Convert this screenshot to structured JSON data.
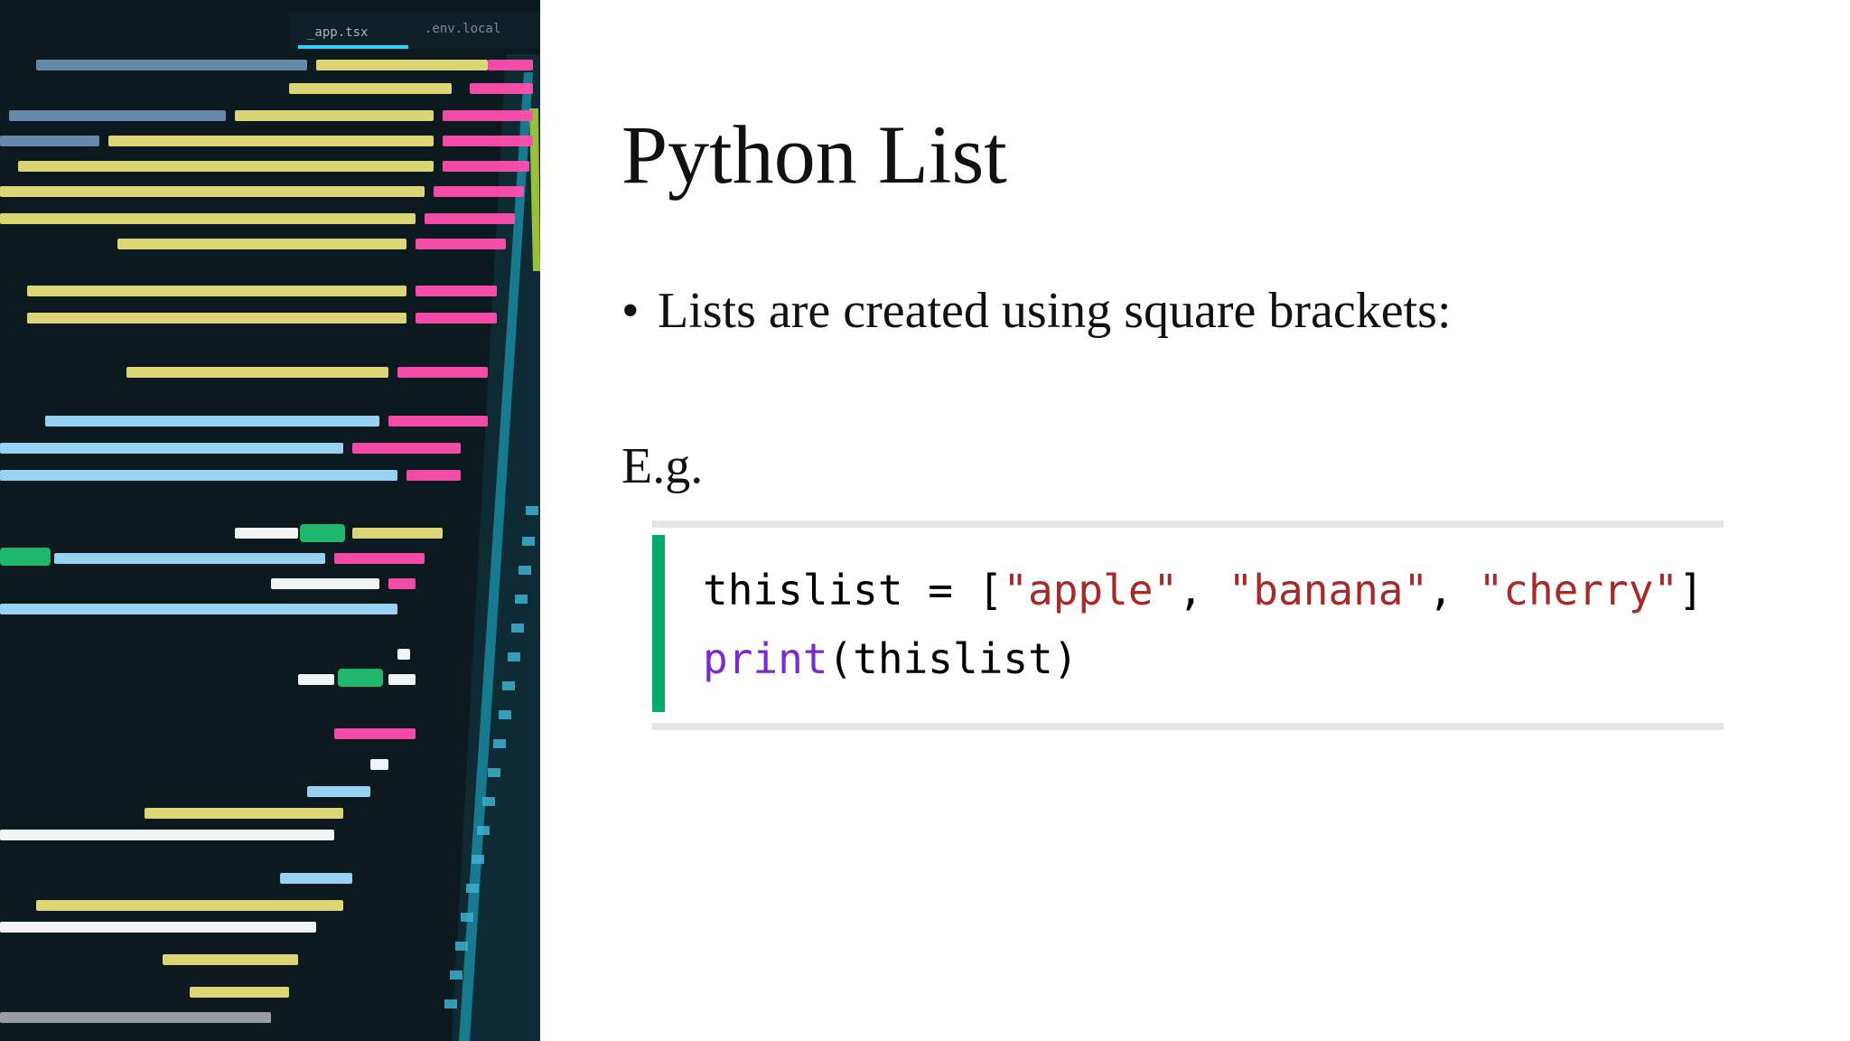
{
  "slide": {
    "title": "Python List",
    "bullet": "Lists are created using square brackets:",
    "example_label": "E.g."
  },
  "code_example": {
    "line1_var": "thislist = [",
    "line1_s1": "\"apple\"",
    "line1_sep1": ", ",
    "line1_s2": "\"banana\"",
    "line1_sep2": ", ",
    "line1_s3": "\"cherry\"",
    "line1_end": "]",
    "line2_fn": "print",
    "line2_rest": "(thislist)"
  },
  "colors": {
    "accent_bar": "#04aa6d",
    "string": "#a52a2a",
    "function": "#7a2bc8",
    "photo_bg": "#0c1a20"
  },
  "image": {
    "description_icon": "code-editor-photo",
    "tabs": [
      "_app.tsx",
      ".env.local"
    ]
  }
}
